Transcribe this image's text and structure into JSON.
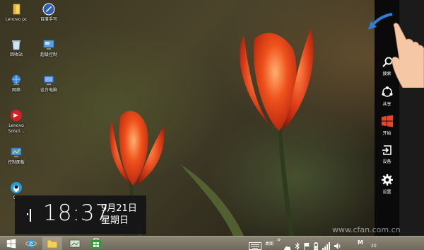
{
  "desktop": {
    "icons": [
      {
        "label": "Lenovo pc",
        "icon": "folder-icon"
      },
      {
        "label": "百度手写",
        "icon": "handwriting-app-icon"
      },
      {
        "label": "回收站",
        "icon": "recycle-bin-icon"
      },
      {
        "label": "超级控制",
        "icon": "control-panel-icon"
      },
      {
        "label": "网络",
        "icon": "network-icon"
      },
      {
        "label": "这台电脑",
        "icon": "this-pc-icon"
      },
      {
        "label": "Lenovo Soluti...",
        "icon": "lenovo-solutions-icon"
      },
      {
        "label": "控制面板",
        "icon": "control-panel-icon"
      },
      {
        "label": "QQ",
        "icon": "qq-icon"
      }
    ]
  },
  "clock": {
    "time": "18:37",
    "date": "9月21日",
    "weekday": "星期日"
  },
  "charms": {
    "search": "搜索",
    "share": "共享",
    "start": "开始",
    "devices": "设备",
    "settings": "设置"
  },
  "taskbar": {
    "desktop_label": "桌面",
    "ime_label": "M",
    "overflow": "»",
    "time_fragment": "20"
  },
  "watermark": "www.cfan.com.cn",
  "colors": {
    "charm_bg": "#0a0a0a",
    "start_red": "#e8472a",
    "taskbar": "#7d786a",
    "gesture_arrow": "#2b7fd6",
    "tulip": "#e8421c"
  }
}
